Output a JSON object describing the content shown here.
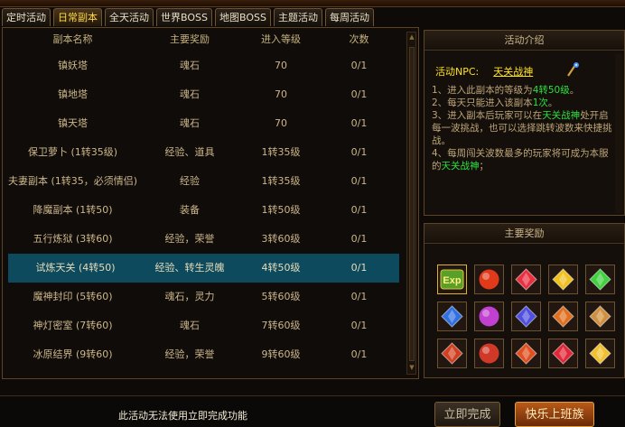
{
  "top_strip": {
    "left_text": "...",
    "right_text": "..."
  },
  "tabs": [
    {
      "label": "定时活动",
      "active": false
    },
    {
      "label": "日常副本",
      "active": true
    },
    {
      "label": "全天活动",
      "active": false
    },
    {
      "label": "世界BOSS",
      "active": false
    },
    {
      "label": "地图BOSS",
      "active": false
    },
    {
      "label": "主题活动",
      "active": false
    },
    {
      "label": "每周活动",
      "active": false
    }
  ],
  "table": {
    "headers": [
      "副本名称",
      "主要奖励",
      "进入等级",
      "次数"
    ],
    "rows": [
      [
        "镇妖塔",
        "魂石",
        "70",
        "0/1"
      ],
      [
        "镇地塔",
        "魂石",
        "70",
        "0/1"
      ],
      [
        "镇天塔",
        "魂石",
        "70",
        "0/1"
      ],
      [
        "保卫萝卜 (1转35级)",
        "经验、道具",
        "1转35级",
        "0/1"
      ],
      [
        "夫妻副本 (1转35，必须情侣)",
        "经验",
        "1转35级",
        "0/1"
      ],
      [
        "降魔副本 (1转50)",
        "装备",
        "1转50级",
        "0/1"
      ],
      [
        "五行炼狱 (3转60)",
        "经验，荣誉",
        "3转60级",
        "0/1"
      ],
      [
        "试炼天关 (4转50)",
        "经验、转生灵魄",
        "4转50级",
        "0/1"
      ],
      [
        "魔神封印 (5转60)",
        "魂石，灵力",
        "5转60级",
        "0/1"
      ],
      [
        "神灯密室 (7转60)",
        "魂石",
        "7转60级",
        "0/1"
      ],
      [
        "冰原结界 (9转60)",
        "经验，荣誉",
        "9转60级",
        "0/1"
      ]
    ],
    "selected_index": 7
  },
  "intro": {
    "title": "活动介绍",
    "npc_label": "活动NPC:",
    "npc_name": "天关战神",
    "line1_a": "1、进入此副本的等级为",
    "line1_b": "4转50级",
    "line1_c": "。",
    "line2_a": "2、每天只能进入该副本",
    "line2_b": "1次",
    "line2_c": "。",
    "line3_a": "3、进入副本后玩家可以在",
    "line3_b": "天关战神",
    "line3_c": "处开启每一波挑战，也可以选择跳转波数来快捷挑战。",
    "line4_a": "4、每周闯关波数最多的玩家将可成为本服的",
    "line4_b": "天关战神",
    "line4_c": "；"
  },
  "rewards": {
    "title": "主要奖励",
    "exp_label": "Exp",
    "items": [
      {
        "icon": "exp-icon",
        "color": "#5aa028"
      },
      {
        "icon": "red-orb-icon",
        "color": "#e03a1a"
      },
      {
        "icon": "red-gem-icon",
        "color": "#e83040"
      },
      {
        "icon": "yellow-gem-icon",
        "color": "#f0c020"
      },
      {
        "icon": "green-gem-icon",
        "color": "#40d040"
      },
      {
        "icon": "blue-crystal-icon",
        "color": "#3070e0"
      },
      {
        "icon": "purple-crystal-icon",
        "color": "#c040d0"
      },
      {
        "icon": "blue-diamond-icon",
        "color": "#5050e0"
      },
      {
        "icon": "orange-rune-icon",
        "color": "#e07020"
      },
      {
        "icon": "scroll-icon",
        "color": "#d09040"
      },
      {
        "icon": "shield-emblem-icon",
        "color": "#d04020"
      },
      {
        "icon": "red-orb-rune-icon",
        "color": "#d03828"
      },
      {
        "icon": "fire-rune-icon",
        "color": "#e05020"
      },
      {
        "icon": "red-diamond-icon",
        "color": "#e02838"
      },
      {
        "icon": "gold-diamond-icon",
        "color": "#f0c030"
      }
    ]
  },
  "footer": {
    "notice": "此活动无法使用立即完成功能",
    "complete_button": "立即完成",
    "happy_button": "快乐上班族"
  }
}
